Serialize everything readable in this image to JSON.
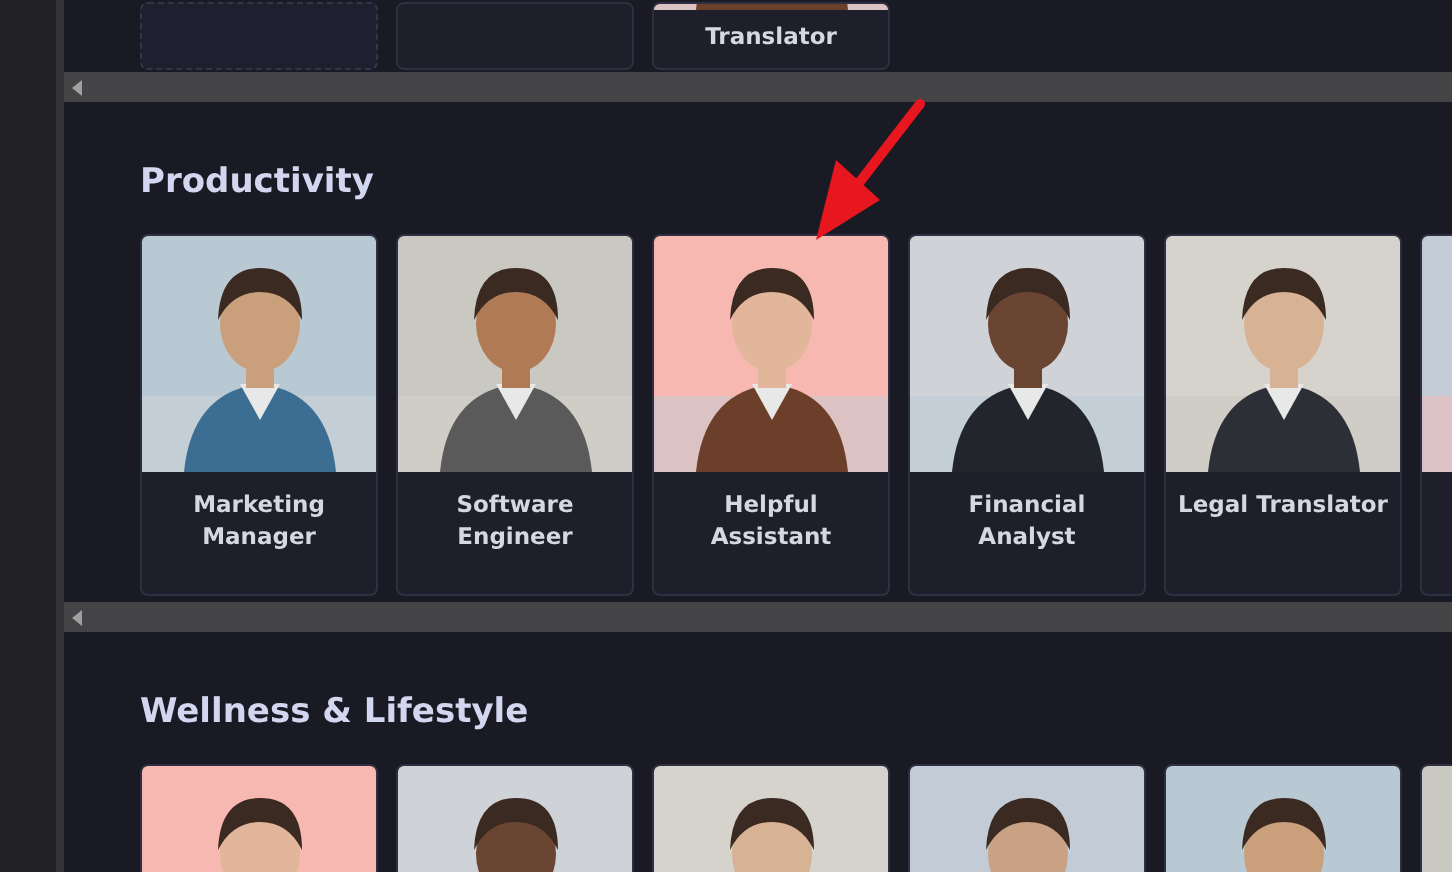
{
  "top_row": {
    "cards": [
      {
        "kind": "empty"
      },
      {
        "kind": "empty"
      },
      {
        "kind": "avatar",
        "label": "Translator"
      }
    ]
  },
  "sections": [
    {
      "title": "Productivity",
      "cards": [
        {
          "kind": "avatar",
          "label": "Marketing Manager"
        },
        {
          "kind": "avatar",
          "label": "Software Engineer"
        },
        {
          "kind": "avatar",
          "label": "Helpful Assistant"
        },
        {
          "kind": "avatar",
          "label": "Financial Analyst"
        },
        {
          "kind": "avatar",
          "label": "Legal Translator"
        },
        {
          "kind": "avatar"
        }
      ]
    },
    {
      "title": "Wellness & Lifestyle",
      "cards": [
        {
          "kind": "avatar"
        },
        {
          "kind": "avatar"
        },
        {
          "kind": "avatar"
        },
        {
          "kind": "avatar"
        },
        {
          "kind": "avatar"
        },
        {
          "kind": "avatar"
        }
      ]
    }
  ]
}
